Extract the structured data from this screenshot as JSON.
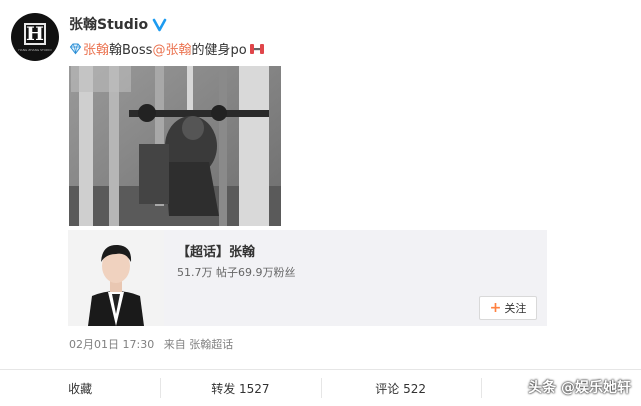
{
  "account": {
    "name": "张翰Studio",
    "avatar_logo_letter": "H",
    "avatar_logo_text": "HANG ZHANG STUDIO"
  },
  "post": {
    "mention1": "张翰",
    "text_middle": " 翰Boss",
    "mention2": "@张翰",
    "text_end": " 的健身po",
    "icons": [
      "diamond-icon",
      "dumbbell-icon"
    ]
  },
  "topic": {
    "title": "【超话】张翰",
    "stats": "51.7万 帖子69.9万粉丝",
    "follow_label": "关注"
  },
  "meta": {
    "time": "02月01日 17:30",
    "source": "来自 张翰超话"
  },
  "actions": {
    "favorite": "收藏",
    "repost": "转发 1527",
    "comment": "评论 522",
    "like": ""
  },
  "watermark": "头条 @娱乐她轩",
  "colors": {
    "mention": "#eb7350",
    "verified": "#1d9bf0",
    "follow_plus": "#ff8140"
  }
}
